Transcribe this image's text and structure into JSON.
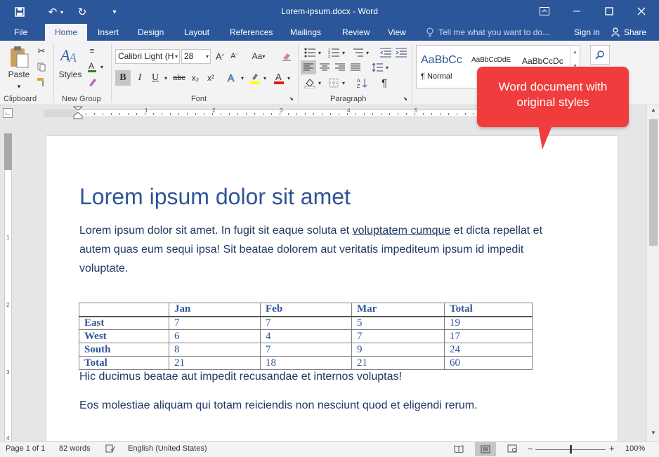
{
  "titlebar": {
    "document_title": "Lorem-ipsum.docx - Word",
    "quick_access": [
      "save-icon",
      "undo-icon",
      "redo-icon",
      "customize-icon"
    ],
    "window_buttons": [
      "ribbon-display-icon",
      "minimize-icon",
      "maximize-icon",
      "close-icon"
    ]
  },
  "tabs": {
    "file": "File",
    "home": "Home",
    "insert": "Insert",
    "design": "Design",
    "layout": "Layout",
    "references": "References",
    "mailings": "Mailings",
    "review": "Review",
    "view": "View",
    "tell_me": "Tell me what you want to do...",
    "sign_in": "Sign in",
    "share": "Share"
  },
  "ribbon": {
    "clipboard": {
      "label": "Clipboard",
      "paste": "Paste"
    },
    "new_group": {
      "label": "New Group",
      "styles": "Styles"
    },
    "font": {
      "label": "Font",
      "font_name": "Calibri Light (H",
      "font_size": "28",
      "bold": "B",
      "italic": "I",
      "underline": "U",
      "strike": "abc",
      "subscript": "x₂",
      "superscript": "x²",
      "change_case": "Aa"
    },
    "paragraph": {
      "label": "Paragraph"
    },
    "styles": {
      "samples": [
        "AaBbCc",
        "AaBbCcDdE",
        "AaBbCcDc"
      ],
      "normal_label": "¶ Normal"
    }
  },
  "ruler": {
    "marks": [
      "1",
      "2",
      "3",
      "4",
      "5",
      "6"
    ]
  },
  "vruler": {
    "marks": [
      "1",
      "2",
      "3",
      "4"
    ]
  },
  "document": {
    "heading": "Lorem ipsum dolor sit amet",
    "para1_a": "Lorem ipsum dolor sit amet. In fugit sit eaque soluta et ",
    "para1_link": "voluptatem cumque",
    "para1_b": " et dicta repellat et",
    "para1_line2": "autem quas eum sequi ipsa! Sit beatae dolorem aut veritatis impediteum ipsum id impedit",
    "para1_line3": "voluptate.",
    "table": {
      "headers": [
        "",
        "Jan",
        "Feb",
        "Mar",
        "Total"
      ],
      "rows": [
        [
          "East",
          "7",
          "7",
          "5",
          "19"
        ],
        [
          "West",
          "6",
          "4",
          "7",
          "17"
        ],
        [
          "South",
          "8",
          "7",
          "9",
          "24"
        ],
        [
          "Total",
          "21",
          "18",
          "21",
          "60"
        ]
      ]
    },
    "para2": "Hic ducimus beatae aut impedit recusandae et internos voluptas!",
    "para3": "Eos molestiae aliquam qui totam reiciendis non nesciunt quod et eligendi rerum."
  },
  "callout": {
    "line1": "Word document with",
    "line2": "original styles"
  },
  "status": {
    "page": "Page 1 of 1",
    "words": "82 words",
    "language": "English (United States)",
    "zoom": "100%"
  },
  "colors": {
    "accent": "#2b579a",
    "heading": "#2e5596",
    "callout": "#f03c3c"
  }
}
